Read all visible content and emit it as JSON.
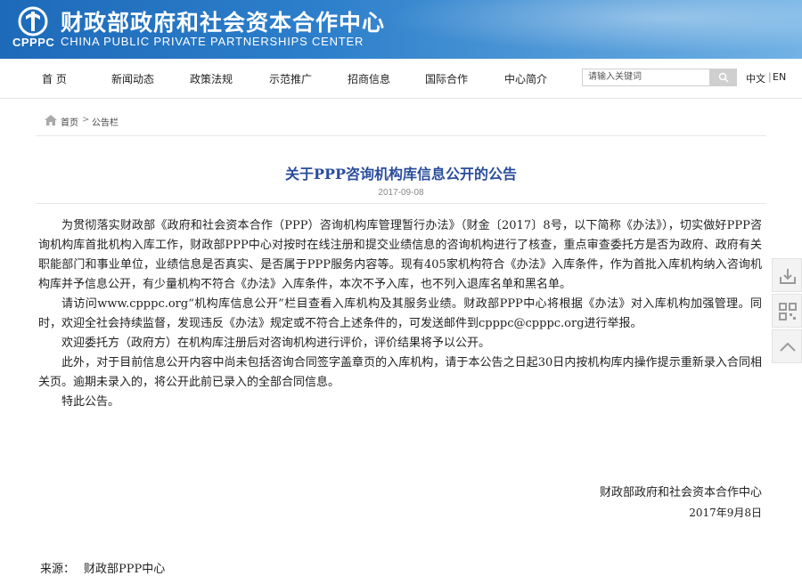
{
  "header": {
    "logo_abbr": "CPPPC",
    "title_cn": "财政部政府和社会资本合作中心",
    "title_en": "CHINA PUBLIC PRIVATE PARTNERSHIPS CENTER"
  },
  "nav": {
    "items": [
      "首 页",
      "新闻动态",
      "政策法规",
      "示范推广",
      "招商信息",
      "国际合作",
      "中心简介"
    ],
    "search_placeholder": "请输入关键词",
    "lang_cn": "中文",
    "lang_en": "EN"
  },
  "breadcrumb": {
    "home": "首页",
    "separator": ">",
    "current": "公告栏"
  },
  "article": {
    "title": "关于PPP咨询机构库信息公开的公告",
    "date": "2017-09-08",
    "paragraphs": [
      "为贯彻落实财政部《政府和社会资本合作（PPP）咨询机构库管理暂行办法》（财金〔2017〕8号，以下简称《办法》），切实做好PPP咨询机构库首批机构入库工作，财政部PPP中心对按时在线注册和提交业绩信息的咨询机构进行了核查，重点审查委托方是否为政府、政府有关职能部门和事业单位，业绩信息是否真实、是否属于PPP服务内容等。现有405家机构符合《办法》入库条件，作为首批入库机构纳入咨询机构库并予信息公开，有少量机构不符合《办法》入库条件，本次不予入库，也不列入退库名单和黑名单。",
      "请访问www.cpppc.org“机构库信息公开”栏目查看入库机构及其服务业绩。财政部PPP中心将根据《办法》对入库机构加强管理。同时，欢迎全社会持续监督，发现违反《办法》规定或不符合上述条件的，可发送邮件到cpppc@cpppc.org进行举报。",
      "欢迎委托方（政府方）在机构库注册后对咨询机构进行评价，评价结果将予以公开。",
      "此外，对于目前信息公开内容中尚未包括咨询合同签字盖章页的入库机构，请于本公告之日起30日内按机构库内操作提示重新录入合同相关页。逾期未录入的，将公开此前已录入的全部合同信息。",
      "特此公告。"
    ],
    "sign_org": "财政部政府和社会资本合作中心",
    "sign_date": "2017年9月8日",
    "source_label": "来源：",
    "source_value": "财政部PPP中心"
  },
  "float_toolbar": [
    "download-icon",
    "qrcode-icon",
    "back-to-top-icon"
  ],
  "colors": {
    "header_blue": "#1d6ab9",
    "title_blue": "#2a4d9b"
  }
}
